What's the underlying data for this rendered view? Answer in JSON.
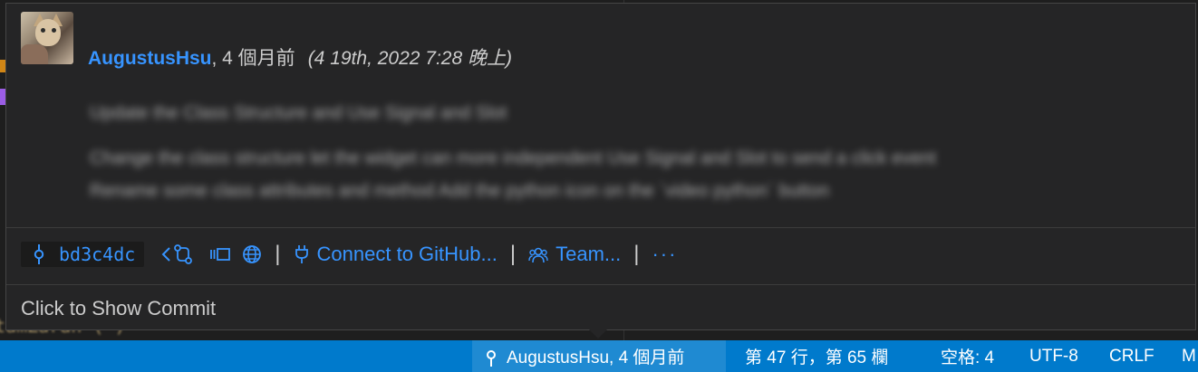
{
  "hover": {
    "author": "AugustusHsu",
    "relative_time": ", 4 個月前",
    "absolute_date": "(4 19th, 2022 7:28 晚上)",
    "message_lines": [
      "Update the Class Structure and Use Signal and Slot",
      "Change the class structure let the widget can more independent Use Signal and Slot to send a click event",
      "Rename some class attributes and method Add the python icon on the `video python` button"
    ],
    "commit_sha": "bd3c4dc",
    "connect_label": "Connect to GitHub...",
    "team_label": "Team...",
    "more_label": "···",
    "separator": "|",
    "show_commit_label": "Click to Show Commit"
  },
  "statusbar": {
    "blame": "AugustusHsu, 4 個月前",
    "position": "第 47 行，第 65 欄",
    "spaces": "空格: 4",
    "encoding": "UTF-8",
    "eol": "CRLF",
    "mode": "M"
  },
  "colors": {
    "accent": "#3794ff",
    "statusbar": "#007acc",
    "hover_bg": "#252526",
    "text": "#cccccc"
  },
  "icons": [
    "git-commit-icon",
    "chevron-left-icon",
    "compare-changes-icon",
    "open-in-panel-icon",
    "globe-icon",
    "plug-icon",
    "team-icon"
  ]
}
